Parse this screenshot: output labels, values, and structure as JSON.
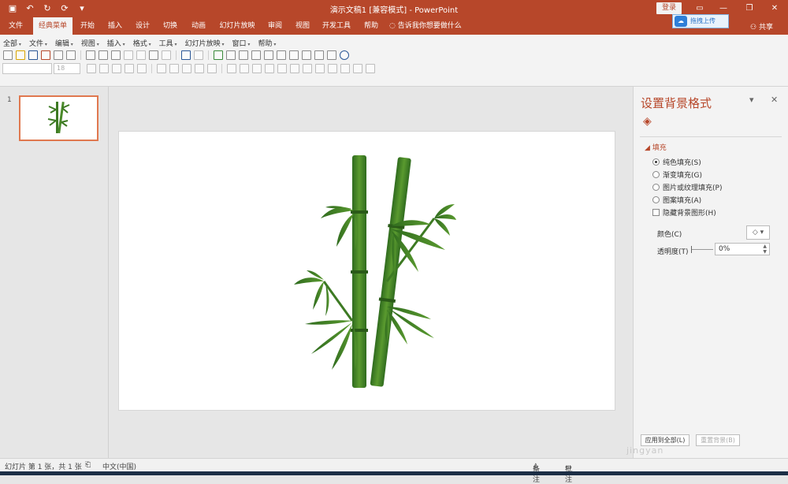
{
  "window": {
    "title": "演示文稿1 [兼容模式] - PowerPoint",
    "login_label": "登录",
    "upload_label": "拖拽上传",
    "share_label": "共享"
  },
  "quick_access": {
    "icons": [
      "save-icon",
      "undo-icon",
      "redo-icon",
      "repeat-icon",
      "customize-icon"
    ]
  },
  "tabs": [
    {
      "label": "文件"
    },
    {
      "label": "经典菜单"
    },
    {
      "label": "开始"
    },
    {
      "label": "插入"
    },
    {
      "label": "设计"
    },
    {
      "label": "切换"
    },
    {
      "label": "动画"
    },
    {
      "label": "幻灯片放映"
    },
    {
      "label": "审阅"
    },
    {
      "label": "视图"
    },
    {
      "label": "开发工具"
    },
    {
      "label": "帮助"
    },
    {
      "label": "告诉我你想要做什么"
    }
  ],
  "menu": {
    "items": [
      {
        "label": "全部"
      },
      {
        "label": "文件"
      },
      {
        "label": "编辑"
      },
      {
        "label": "视图"
      },
      {
        "label": "插入"
      },
      {
        "label": "格式"
      },
      {
        "label": "工具"
      },
      {
        "label": "幻灯片放映"
      },
      {
        "label": "窗口"
      },
      {
        "label": "帮助"
      }
    ]
  },
  "font": {
    "size_placeholder": "18"
  },
  "thumbnails": {
    "number": "1"
  },
  "format_background": {
    "title": "设置背景格式",
    "section": "填充",
    "options": [
      {
        "label": "纯色填充(S)",
        "selected": true
      },
      {
        "label": "渐变填充(G)",
        "selected": false
      },
      {
        "label": "图片或纹理填充(P)",
        "selected": false
      },
      {
        "label": "图案填充(A)",
        "selected": false
      }
    ],
    "hide_graphics_label": "隐藏背景图形(H)",
    "color_label": "颜色(C)",
    "transparency_label": "透明度(T)",
    "transparency_value": "0%",
    "apply_all_label": "应用到全部(L)",
    "reset_label": "重置背景(B)"
  },
  "status": {
    "slide_info": "幻灯片 第 1 张，共 1 张",
    "language": "中文(中国)",
    "notes_label": "备注",
    "comments_label": "批注"
  },
  "colors": {
    "accent": "#b7472a",
    "bamboo_dark": "#2f6b1e",
    "bamboo_light": "#5a9a2f"
  }
}
